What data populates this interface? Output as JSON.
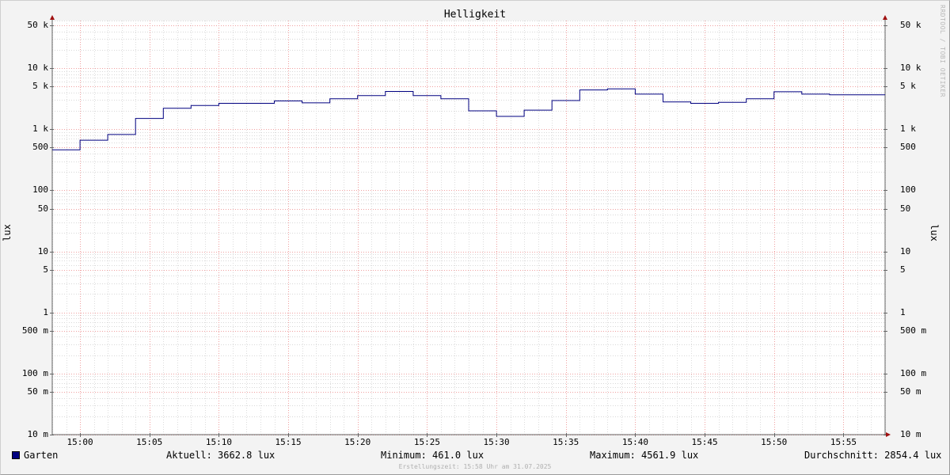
{
  "chart_data": {
    "type": "line",
    "title": "Helligkeit",
    "ylabel": "lux",
    "yscale": "log",
    "ylim": [
      0.01,
      60000
    ],
    "y_ticks": [
      {
        "value": 0.01,
        "label": "10 m"
      },
      {
        "value": 0.05,
        "label": "50 m"
      },
      {
        "value": 0.1,
        "label": "100 m"
      },
      {
        "value": 0.5,
        "label": "500 m"
      },
      {
        "value": 1,
        "label": "1"
      },
      {
        "value": 5,
        "label": "5"
      },
      {
        "value": 10,
        "label": "10"
      },
      {
        "value": 50,
        "label": "50"
      },
      {
        "value": 100,
        "label": "100"
      },
      {
        "value": 500,
        "label": "500"
      },
      {
        "value": 1000,
        "label": "1 k"
      },
      {
        "value": 5000,
        "label": "5 k"
      },
      {
        "value": 10000,
        "label": "10 k"
      },
      {
        "value": 50000,
        "label": "50 k"
      }
    ],
    "xlim": [
      "14:58",
      "15:58"
    ],
    "x_ticks": [
      "15:00",
      "15:05",
      "15:10",
      "15:15",
      "15:20",
      "15:25",
      "15:30",
      "15:35",
      "15:40",
      "15:45",
      "15:50",
      "15:55"
    ],
    "grid": true,
    "series": [
      {
        "name": "Garten",
        "color": "#000080",
        "step": true,
        "points": [
          {
            "t": "14:58",
            "v": 461
          },
          {
            "t": "15:00",
            "v": 660
          },
          {
            "t": "15:02",
            "v": 820
          },
          {
            "t": "15:04",
            "v": 1500
          },
          {
            "t": "15:06",
            "v": 2200
          },
          {
            "t": "15:08",
            "v": 2450
          },
          {
            "t": "15:10",
            "v": 2650
          },
          {
            "t": "15:14",
            "v": 2900
          },
          {
            "t": "15:16",
            "v": 2700
          },
          {
            "t": "15:18",
            "v": 3150
          },
          {
            "t": "15:20",
            "v": 3550
          },
          {
            "t": "15:22",
            "v": 4150
          },
          {
            "t": "15:24",
            "v": 3550
          },
          {
            "t": "15:26",
            "v": 3150
          },
          {
            "t": "15:28",
            "v": 2000
          },
          {
            "t": "15:30",
            "v": 1620
          },
          {
            "t": "15:32",
            "v": 2050
          },
          {
            "t": "15:34",
            "v": 2950
          },
          {
            "t": "15:36",
            "v": 4400
          },
          {
            "t": "15:38",
            "v": 4561.9
          },
          {
            "t": "15:40",
            "v": 3750
          },
          {
            "t": "15:42",
            "v": 2800
          },
          {
            "t": "15:44",
            "v": 2650
          },
          {
            "t": "15:46",
            "v": 2750
          },
          {
            "t": "15:48",
            "v": 3150
          },
          {
            "t": "15:50",
            "v": 4100
          },
          {
            "t": "15:52",
            "v": 3750
          },
          {
            "t": "15:54",
            "v": 3662.8
          },
          {
            "t": "15:58",
            "v": 3662.8
          }
        ]
      }
    ]
  },
  "legend": {
    "series_color": "#000080",
    "series_name": "Garten",
    "current": "Aktuell: 3662.8 lux",
    "minimum": "Minimum: 461.0 lux",
    "maximum": "Maximum: 4561.9 lux",
    "average": "Durchschnitt: 2854.4 lux"
  },
  "footer": {
    "created": "Erstellungszeit: 15:58 Uhr am 31.07.2025",
    "watermark": "RRDTOOL / TOBI OETIKER"
  }
}
